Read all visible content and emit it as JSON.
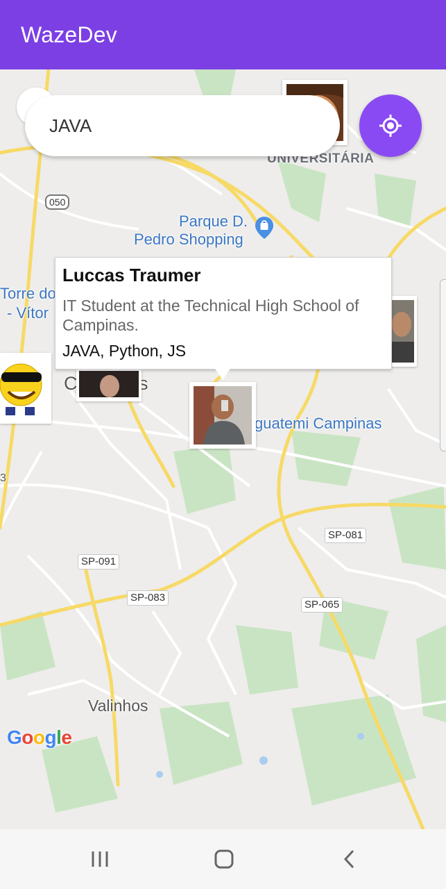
{
  "app": {
    "title": "WazeDev"
  },
  "search": {
    "value": "JAVA"
  },
  "map": {
    "labels": {
      "universitaria": "UNIVERSITÁRIA",
      "parque_line1": "Parque D.",
      "parque_line2": "Pedro Shopping",
      "torre_line1": "Torre do",
      "torre_line2": "- Vítor",
      "campinas_fragment": "C",
      "campinas_fragment2": "s",
      "iguatemi": "guatemi Campinas",
      "valinhos": "Valinhos",
      "edge_3": "3"
    },
    "roads": [
      "050",
      "SP-081",
      "SP-091",
      "SP-083",
      "SP-065"
    ],
    "attribution": [
      "G",
      "o",
      "o",
      "g",
      "l",
      "e"
    ]
  },
  "callout": {
    "name": "Luccas Traumer",
    "bio": "IT Student at the Technical High School of Campinas.",
    "techs": "JAVA, Python, JS"
  },
  "colors": {
    "app_bar": "#7b3fe4",
    "locate_button": "#8a4af3"
  },
  "icons": {
    "locate": "my-location-icon",
    "recent": "recent-apps-icon",
    "home": "home-icon",
    "back": "back-icon"
  }
}
